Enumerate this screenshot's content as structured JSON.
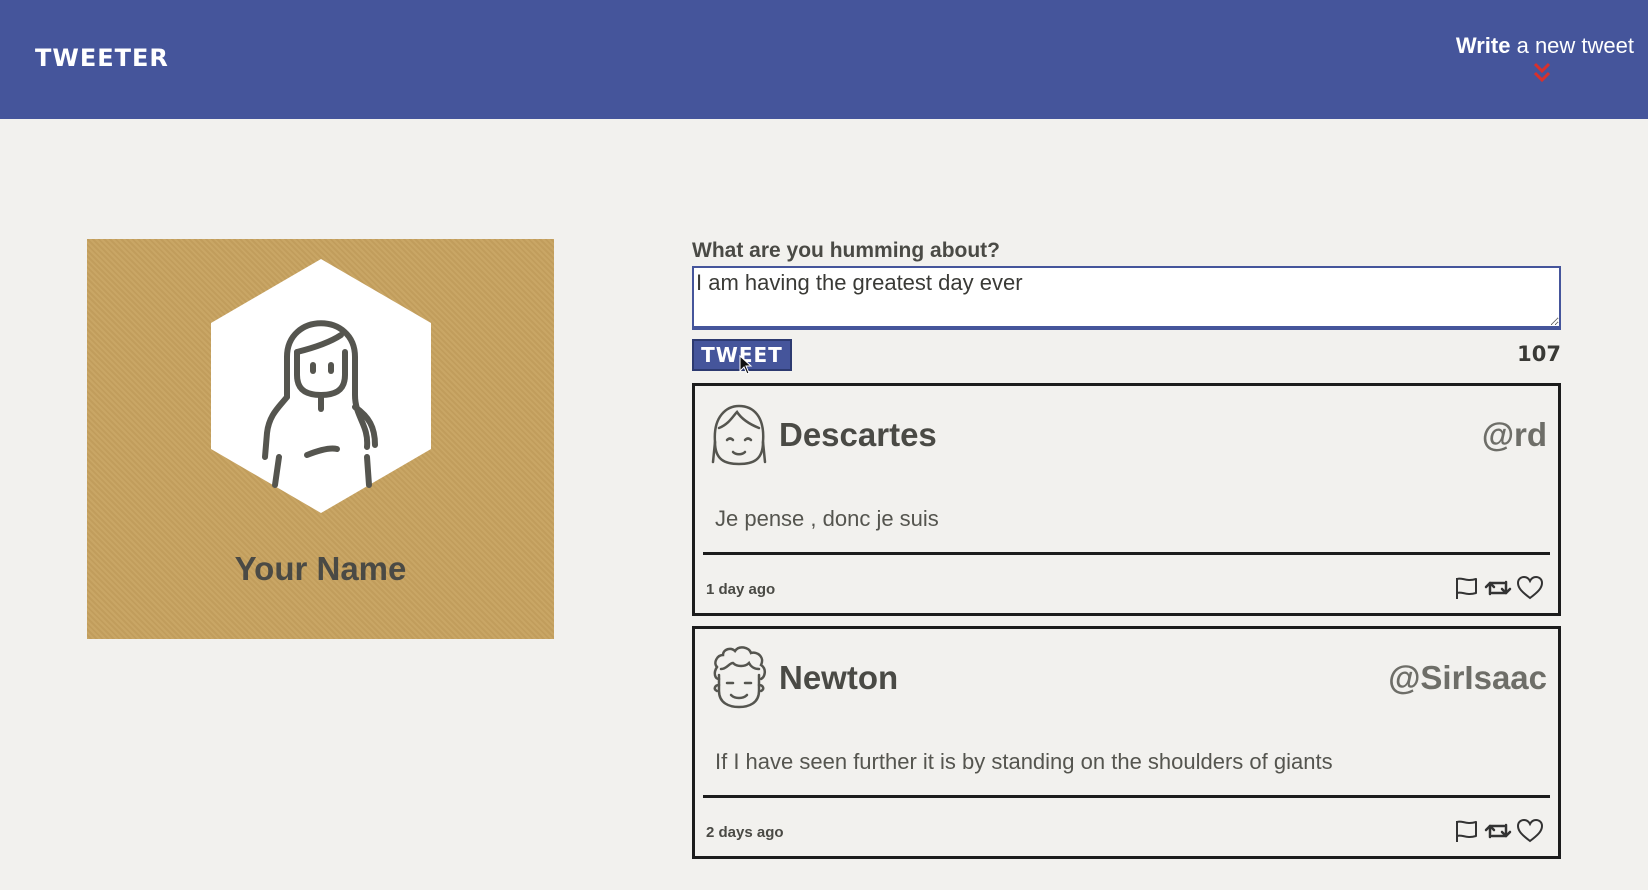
{
  "nav": {
    "brand": "TWEETER",
    "compose_bold": "Write",
    "compose_rest": "a new tweet",
    "compose_icon": "chevron-double-down-icon",
    "accent": "#45559b",
    "chevron_color": "#d9302c"
  },
  "profile": {
    "name": "Your Name",
    "avatar_icon": "woman-avatar-icon",
    "background": "#c7a25f"
  },
  "composer": {
    "label": "What are you humming about?",
    "value": "I am having the greatest day ever",
    "button_label": "TWEET",
    "counter": "107"
  },
  "tweets": [
    {
      "name": "Descartes",
      "handle": "@rd",
      "body": "Je pense , donc je suis",
      "time": "1 day ago",
      "avatar_icon": "girl-face-icon"
    },
    {
      "name": "Newton",
      "handle": "@SirIsaac",
      "body": "If I have seen further it is by standing on the shoulders of giants",
      "time": "2 days ago",
      "avatar_icon": "curly-hair-face-icon"
    }
  ]
}
